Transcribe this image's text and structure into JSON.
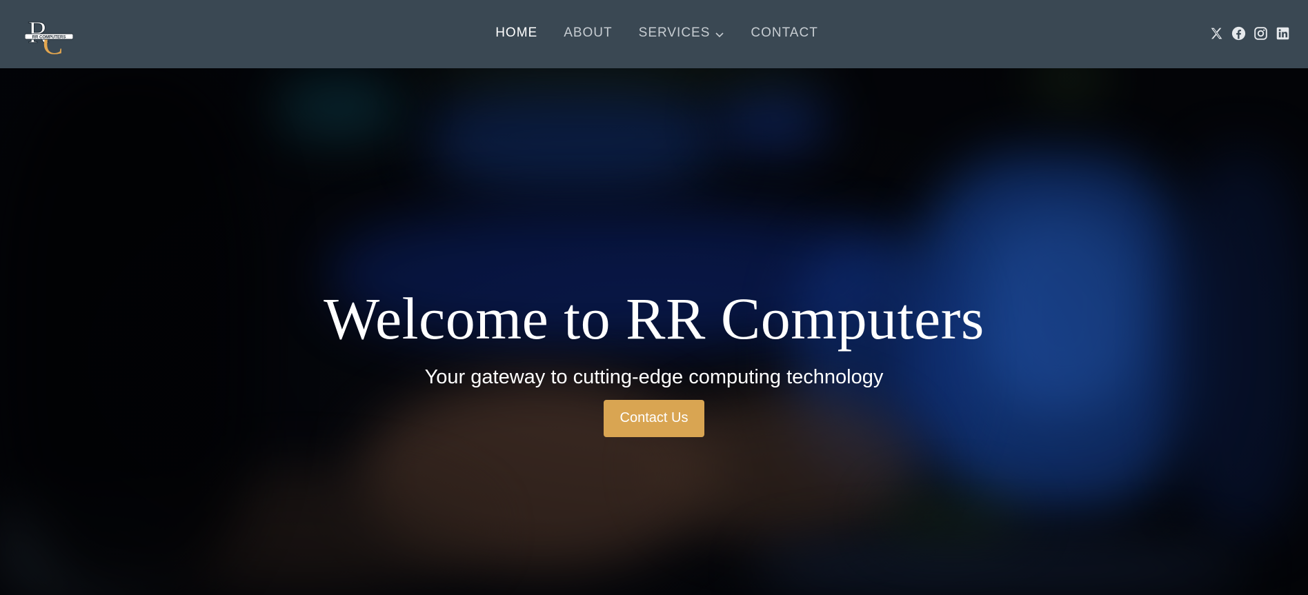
{
  "header": {
    "logo_icon": "rr-computers-logo",
    "logo_text": "RR COMPUTERS",
    "nav": [
      {
        "label": "HOME",
        "active": true
      },
      {
        "label": "ABOUT",
        "active": false
      },
      {
        "label": "SERVICES",
        "active": false,
        "has_dropdown": true
      },
      {
        "label": "CONTACT",
        "active": false
      }
    ],
    "social_icons": [
      "x-icon",
      "facebook-icon",
      "instagram-icon",
      "linkedin-icon"
    ],
    "background_color": "#3a4853"
  },
  "hero": {
    "title": "Welcome to RR Computers",
    "subtitle": "Your gateway to cutting-edge computing technology",
    "cta_label": "Contact Us",
    "cta_color": "#d9a552",
    "background": "blurred photo of hands typing on a keyboard in front of blue-lit monitors"
  }
}
